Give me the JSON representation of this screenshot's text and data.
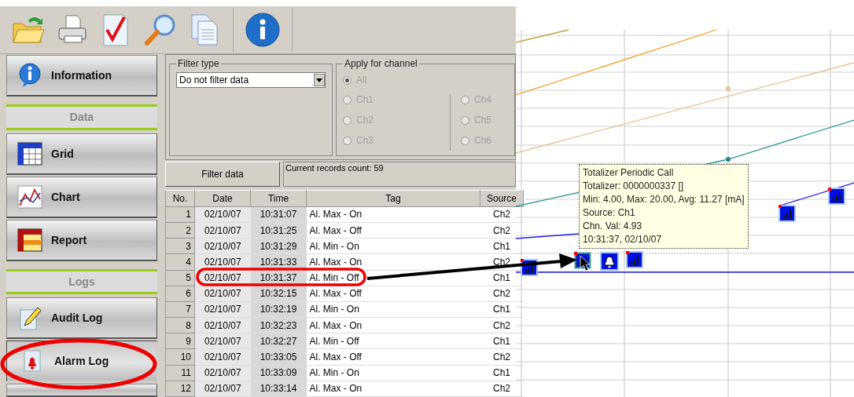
{
  "sidebar": {
    "items": [
      {
        "kind": "button",
        "label": "Information",
        "selected": false
      },
      {
        "kind": "header",
        "label": "Data"
      },
      {
        "kind": "button",
        "label": "Grid",
        "selected": false
      },
      {
        "kind": "button",
        "label": "Chart",
        "selected": false
      },
      {
        "kind": "button",
        "label": "Report",
        "selected": false
      },
      {
        "kind": "header",
        "label": "Logs"
      },
      {
        "kind": "button",
        "label": "Audit Log",
        "selected": false
      },
      {
        "kind": "button",
        "label": "Alarm Log",
        "selected": true
      }
    ]
  },
  "filter_type": {
    "legend": "Filter type",
    "value": "Do not filter data"
  },
  "apply_for_channel": {
    "legend": "Apply for channel",
    "options": [
      {
        "label": "All",
        "selected": true,
        "disabled": true
      },
      {
        "label": "Ch1",
        "selected": false,
        "disabled": true
      },
      {
        "label": "Ch2",
        "selected": false,
        "disabled": true
      },
      {
        "label": "Ch3",
        "selected": false,
        "disabled": true
      },
      {
        "label": "Ch4",
        "selected": false,
        "disabled": true
      },
      {
        "label": "Ch5",
        "selected": false,
        "disabled": true
      },
      {
        "label": "Ch6",
        "selected": false,
        "disabled": true
      }
    ]
  },
  "filter_button": "Filter data",
  "records_count": "Current records count: 59",
  "table": {
    "columns": [
      "No.",
      "Date",
      "Time",
      "Tag",
      "Source"
    ],
    "rows": [
      [
        "1",
        "02/10/07",
        "10:31:07",
        "Al. Max - On",
        "Ch2"
      ],
      [
        "2",
        "02/10/07",
        "10:31:25",
        "Al. Max - Off",
        "Ch2"
      ],
      [
        "3",
        "02/10/07",
        "10:31:29",
        "Al. Min - On",
        "Ch1"
      ],
      [
        "4",
        "02/10/07",
        "10:31:33",
        "Al. Max - On",
        "Ch2"
      ],
      [
        "5",
        "02/10/07",
        "10:31:37",
        "Al. Min - Off",
        "Ch1"
      ],
      [
        "6",
        "02/10/07",
        "10:32:15",
        "Al. Max - Off",
        "Ch2"
      ],
      [
        "7",
        "02/10/07",
        "10:32:19",
        "Al. Min - On",
        "Ch1"
      ],
      [
        "8",
        "02/10/07",
        "10:32:23",
        "Al. Max - On",
        "Ch2"
      ],
      [
        "9",
        "02/10/07",
        "10:32:27",
        "Al. Min - Off",
        "Ch1"
      ],
      [
        "10",
        "02/10/07",
        "10:33:05",
        "Al. Max - Off",
        "Ch2"
      ],
      [
        "11",
        "02/10/07",
        "10:33:09",
        "Al. Min - On",
        "Ch1"
      ],
      [
        "12",
        "02/10/07",
        "10:33:14",
        "Al. Max - On",
        "Ch2"
      ]
    ]
  },
  "chart_tooltip": [
    "Totalizer Periodic Call",
    "Totalizer: 0000000337 []",
    "Min: 4.00, Max: 20.00, Avg: 11.27 [mA]",
    "Source: Ch1",
    "Chn. Val: 4.93",
    "10:31:37, 02/10/07"
  ]
}
